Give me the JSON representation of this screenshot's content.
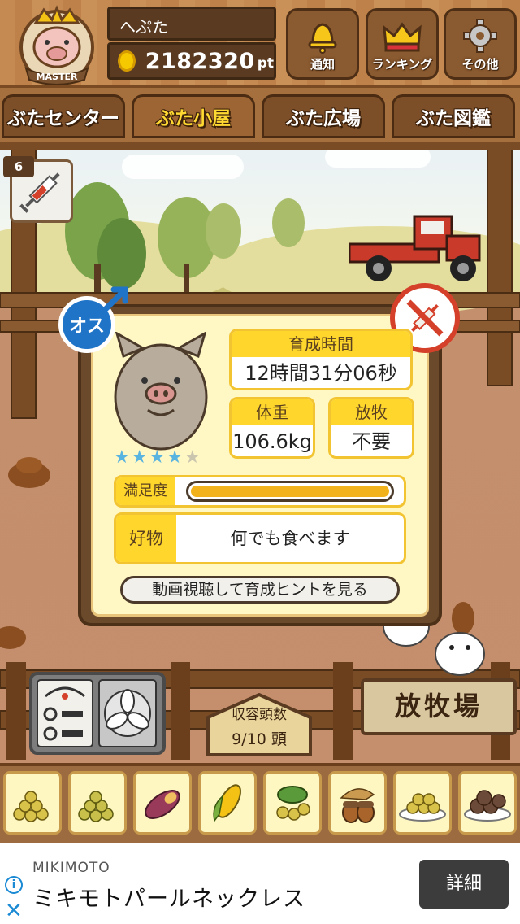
{
  "header": {
    "badge_text": "MASTER",
    "user_name": "へぷた",
    "points": "2182320",
    "points_unit": "pt",
    "buttons": [
      {
        "label": "通知",
        "icon": "bell-icon"
      },
      {
        "label": "ランキング",
        "icon": "crown-icon"
      },
      {
        "label": "その他",
        "icon": "gear-icon"
      }
    ]
  },
  "tabs": [
    {
      "label": "ぶたセンター"
    },
    {
      "label": "ぶた小屋"
    },
    {
      "label": "ぶた広場"
    },
    {
      "label": "ぶた図鑑"
    }
  ],
  "item": {
    "count": "6",
    "icon": "syringe-icon"
  },
  "pig": {
    "sex": "オス",
    "raising_time_label": "育成時間",
    "raising_time": "12時間31分06秒",
    "weight_label": "体重",
    "weight": "106.6kg",
    "grazing_label": "放牧",
    "grazing": "不要",
    "stars": 4,
    "stars_max": 5,
    "satisfaction_label": "満足度",
    "satisfaction": 1.0,
    "favorite_label": "好物",
    "favorite": "何でも食べます",
    "hint_button": "動画視聴して育成ヒントを見る"
  },
  "pen": {
    "capacity_label": "収容頭数",
    "capacity": "9/10 頭",
    "pasture_label": "放牧場"
  },
  "foods": [
    {
      "icon": "grain-pile-icon"
    },
    {
      "icon": "grain-pile-icon"
    },
    {
      "icon": "sweet-potato-icon"
    },
    {
      "icon": "corn-icon"
    },
    {
      "icon": "vegetables-icon"
    },
    {
      "icon": "acorn-icon"
    },
    {
      "icon": "grain-plate-icon"
    },
    {
      "icon": "meat-plate-icon"
    }
  ],
  "ad": {
    "brand": "MIKIMOTO",
    "title": "ミキモトパールネックレス",
    "button": "詳細"
  },
  "colors": {
    "accent_yellow": "#ffd62c",
    "wood": "#8a5a30",
    "male_blue": "#1f74c8",
    "forbidden_red": "#d5402b",
    "star": "#5ab4e0"
  }
}
